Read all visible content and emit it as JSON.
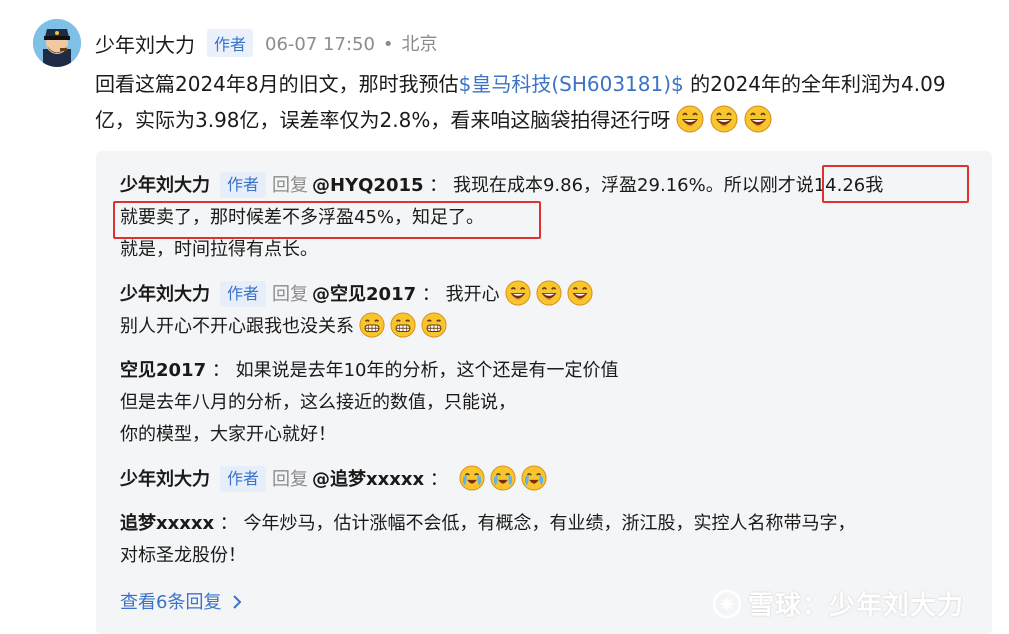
{
  "post": {
    "author": "少年刘大力",
    "badge": "作者",
    "time": "06-07 17:50",
    "dot": "•",
    "location": "北京",
    "text_before": "回看这篇2024年8月的旧文，那时我预估",
    "stock": "$皇马科技(SH603181)$",
    "text_after": " 的2024年的全年利润为4.09亿，实际为3.98亿，误差率仅为2.8%，看来咱这脑袋拍得还行呀"
  },
  "replies": [
    {
      "name": "少年刘大力",
      "badge": "作者",
      "reply_label": "回复",
      "at": "@HYQ2015",
      "sep": "：",
      "text_a": "我现在成本9.86，浮盈29.16%。所以",
      "text_hl1": "刚才说14.26我",
      "text_hl2": "就要卖了，那时候差不多浮盈45%，知足了。",
      "text_b": "就是，时间拉得有点长。"
    },
    {
      "name": "少年刘大力",
      "badge": "作者",
      "reply_label": "回复",
      "at": "@空见2017",
      "sep": "：",
      "text_a": "我开心",
      "text_b": "别人开心不开心跟我也没关系"
    },
    {
      "name": "空见2017",
      "sep": "：",
      "lines": [
        "如果说是去年10年的分析，这个还是有一定价值",
        "但是去年八月的分析，这么接近的数值，只能说，",
        "你的模型，大家开心就好！"
      ]
    },
    {
      "name": "少年刘大力",
      "badge": "作者",
      "reply_label": "回复",
      "at": "@追梦xxxxx",
      "sep": "："
    },
    {
      "name": "追梦xxxxx",
      "sep": "：",
      "lines": [
        "今年炒马，估计涨幅不会低，有概念，有业绩，浙江股，实控人名称带马字，",
        "对标圣龙股份！"
      ]
    }
  ],
  "more_replies": "查看6条回复",
  "watermark": "雪球：少年刘大力",
  "colors": {
    "link": "#3a73c8",
    "highlight": "#e03131",
    "reply_bg": "#f4f5f7"
  }
}
